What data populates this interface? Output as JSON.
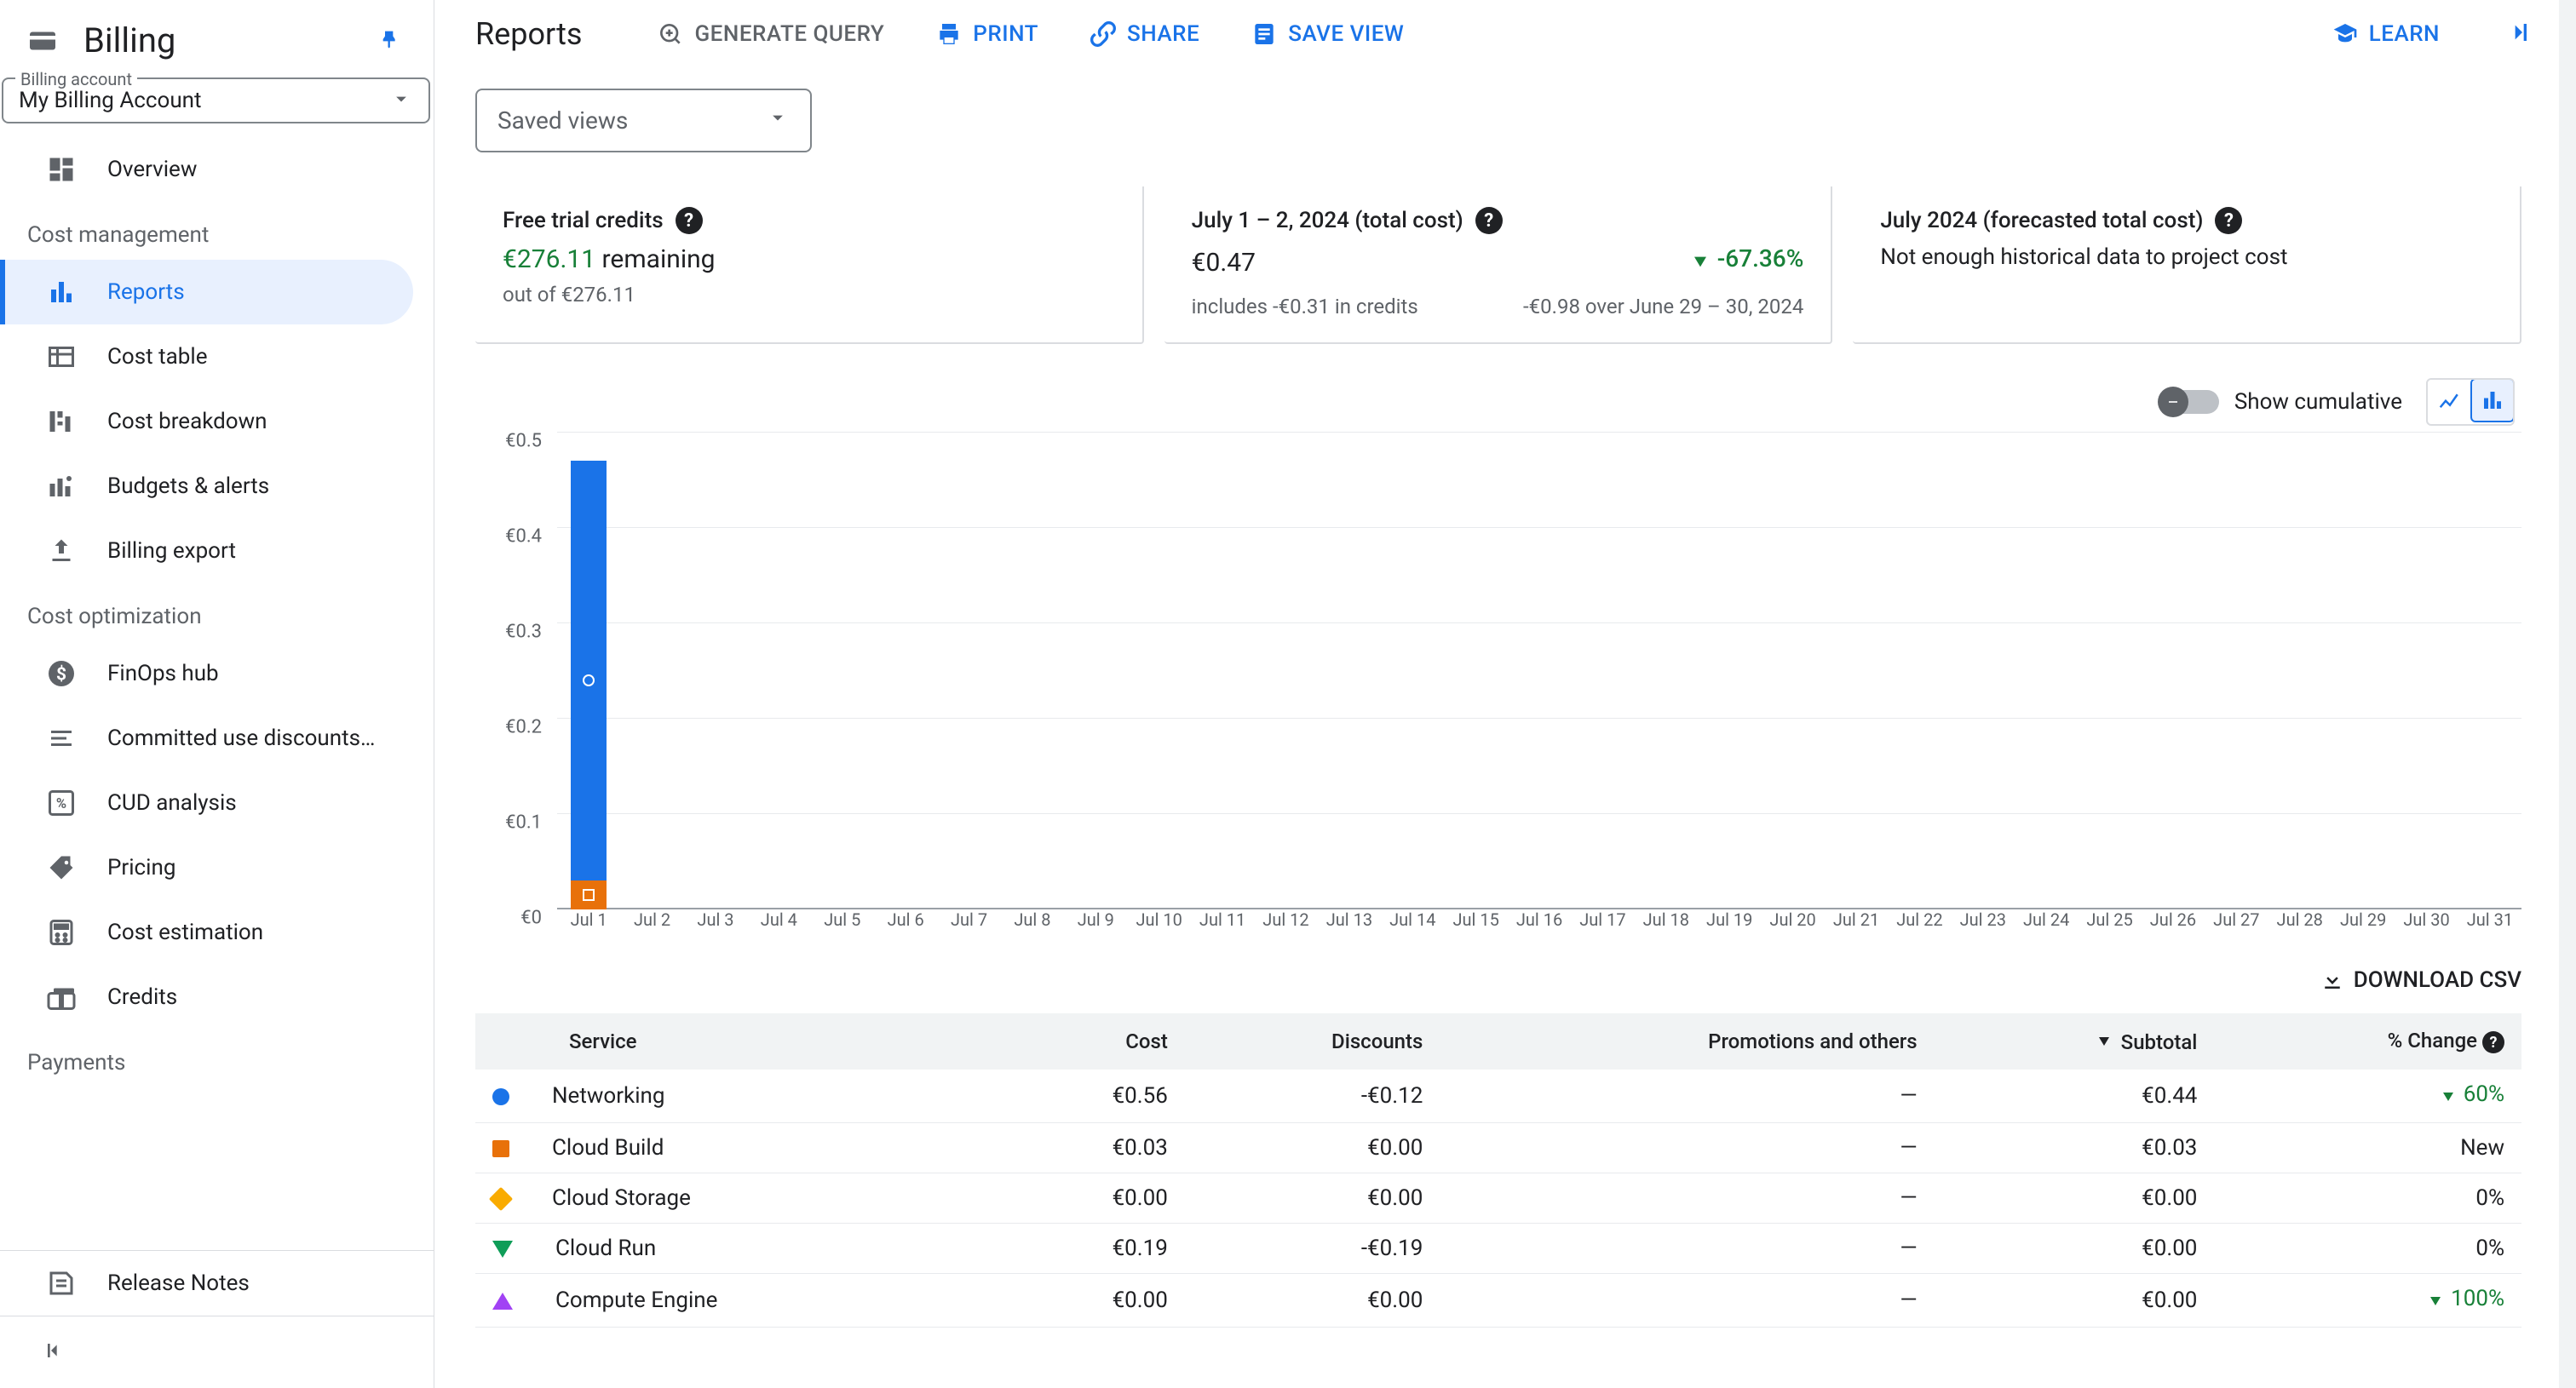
{
  "sidebar": {
    "title": "Billing",
    "account_label": "Billing account",
    "account_value": "My Billing Account",
    "sections": [
      {
        "items": [
          {
            "icon": "dashboard",
            "label": "Overview"
          }
        ]
      },
      {
        "title": "Cost management",
        "items": [
          {
            "icon": "bar-chart",
            "label": "Reports",
            "active": true
          },
          {
            "icon": "table",
            "label": "Cost table"
          },
          {
            "icon": "breakdown",
            "label": "Cost breakdown"
          },
          {
            "icon": "budgets",
            "label": "Budgets & alerts"
          },
          {
            "icon": "export",
            "label": "Billing export"
          }
        ]
      },
      {
        "title": "Cost optimization",
        "items": [
          {
            "icon": "finops",
            "label": "FinOps hub"
          },
          {
            "icon": "committed",
            "label": "Committed use discounts…"
          },
          {
            "icon": "cud",
            "label": "CUD analysis"
          },
          {
            "icon": "pricing",
            "label": "Pricing"
          },
          {
            "icon": "cost-est",
            "label": "Cost estimation"
          },
          {
            "icon": "credits",
            "label": "Credits"
          }
        ]
      },
      {
        "title": "Payments",
        "items": []
      }
    ],
    "release_notes": "Release Notes"
  },
  "topbar": {
    "title": "Reports",
    "buttons": [
      {
        "key": "generate-query",
        "label": "GENERATE QUERY",
        "muted": true
      },
      {
        "key": "print",
        "label": "PRINT"
      },
      {
        "key": "share",
        "label": "SHARE"
      },
      {
        "key": "save-view",
        "label": "SAVE VIEW"
      }
    ],
    "learn": "LEARN"
  },
  "saved_views_label": "Saved views",
  "cards": {
    "trial": {
      "title": "Free trial credits",
      "remaining_amount": "€276.11",
      "remaining_word": "remaining",
      "subtitle": "out of €276.11"
    },
    "period": {
      "title": "July 1 – 2, 2024 (total cost)",
      "amount": "€0.47",
      "delta": "-67.36%",
      "sub_left": "includes -€0.31 in credits",
      "sub_right": "-€0.98 over June 29 – 30, 2024"
    },
    "forecast": {
      "title": "July 2024 (forecasted total cost)",
      "message": "Not enough historical data to project cost"
    }
  },
  "chart_controls": {
    "toggle_label": "Show cumulative"
  },
  "download_label": "DOWNLOAD CSV",
  "table": {
    "headers": [
      "Service",
      "Cost",
      "Discounts",
      "Promotions and others",
      "Subtotal",
      "% Change"
    ],
    "rows": [
      {
        "marker": "circle",
        "color": "#1a73e8",
        "service": "Networking",
        "cost": "€0.56",
        "discounts": "-€0.12",
        "promotions": "—",
        "subtotal": "€0.44",
        "change": "60%",
        "change_dir": "down"
      },
      {
        "marker": "square",
        "color": "#e8710a",
        "service": "Cloud Build",
        "cost": "€0.03",
        "discounts": "€0.00",
        "promotions": "—",
        "subtotal": "€0.03",
        "change": "New",
        "change_dir": "none"
      },
      {
        "marker": "diamond",
        "color": "#f9ab00",
        "service": "Cloud Storage",
        "cost": "€0.00",
        "discounts": "€0.00",
        "promotions": "—",
        "subtotal": "€0.00",
        "change": "0%",
        "change_dir": "none"
      },
      {
        "marker": "tri-down",
        "color": "#0f9d58",
        "service": "Cloud Run",
        "cost": "€0.19",
        "discounts": "-€0.19",
        "promotions": "—",
        "subtotal": "€0.00",
        "change": "0%",
        "change_dir": "none"
      },
      {
        "marker": "tri-up",
        "color": "#a142f4",
        "service": "Compute Engine",
        "cost": "€0.00",
        "discounts": "€0.00",
        "promotions": "—",
        "subtotal": "€0.00",
        "change": "100%",
        "change_dir": "down"
      }
    ]
  },
  "chart_data": {
    "type": "bar",
    "stacked": true,
    "ylabel": "",
    "ylim": [
      0,
      0.5
    ],
    "yticks": [
      "€0",
      "€0.1",
      "€0.2",
      "€0.3",
      "€0.4",
      "€0.5"
    ],
    "categories": [
      "Jul 1",
      "Jul 2",
      "Jul 3",
      "Jul 4",
      "Jul 5",
      "Jul 6",
      "Jul 7",
      "Jul 8",
      "Jul 9",
      "Jul 10",
      "Jul 11",
      "Jul 12",
      "Jul 13",
      "Jul 14",
      "Jul 15",
      "Jul 16",
      "Jul 17",
      "Jul 18",
      "Jul 19",
      "Jul 20",
      "Jul 21",
      "Jul 22",
      "Jul 23",
      "Jul 24",
      "Jul 25",
      "Jul 26",
      "Jul 27",
      "Jul 28",
      "Jul 29",
      "Jul 30",
      "Jul 31"
    ],
    "series": [
      {
        "name": "Networking",
        "color": "#1a73e8",
        "values": [
          0.44,
          0,
          0,
          0,
          0,
          0,
          0,
          0,
          0,
          0,
          0,
          0,
          0,
          0,
          0,
          0,
          0,
          0,
          0,
          0,
          0,
          0,
          0,
          0,
          0,
          0,
          0,
          0,
          0,
          0,
          0
        ]
      },
      {
        "name": "Cloud Build",
        "color": "#e8710a",
        "values": [
          0.03,
          0,
          0,
          0,
          0,
          0,
          0,
          0,
          0,
          0,
          0,
          0,
          0,
          0,
          0,
          0,
          0,
          0,
          0,
          0,
          0,
          0,
          0,
          0,
          0,
          0,
          0,
          0,
          0,
          0,
          0
        ]
      }
    ],
    "markers": [
      {
        "shape": "circle-open",
        "color": "#fff",
        "x": 0,
        "y": 0.24
      },
      {
        "shape": "square-open",
        "color": "#fff",
        "x": 0,
        "y": 0.015
      }
    ]
  }
}
